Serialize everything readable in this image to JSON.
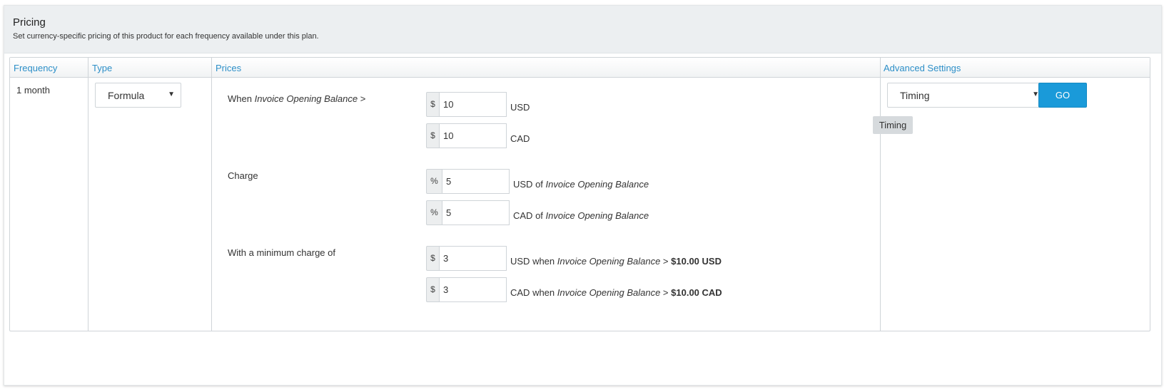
{
  "panel": {
    "title": "Pricing",
    "subtitle": "Set currency-specific pricing of this product for each frequency available under this plan."
  },
  "table": {
    "headers": {
      "frequency": "Frequency",
      "type": "Type",
      "prices": "Prices",
      "advanced": "Advanced Settings"
    },
    "row": {
      "frequency": "1 month",
      "type_selected": "Formula"
    }
  },
  "prices": {
    "when_label_prefix": "When ",
    "when_label_italic": "Invoice Opening Balance",
    "when_label_suffix": " >",
    "charge_label": "Charge",
    "minimum_label": "With a minimum charge of",
    "when_rows": [
      {
        "addon": "$",
        "value": "10",
        "currency": "USD"
      },
      {
        "addon": "$",
        "value": "10",
        "currency": "CAD"
      }
    ],
    "charge_rows": [
      {
        "addon": "%",
        "value": "5",
        "currency": "USD",
        "of_text": " of ",
        "ref": "Invoice Opening Balance"
      },
      {
        "addon": "%",
        "value": "5",
        "currency": "CAD",
        "of_text": " of ",
        "ref": "Invoice Opening Balance"
      }
    ],
    "minimum_rows": [
      {
        "addon": "$",
        "value": "3",
        "currency": "USD",
        "when_text": " when ",
        "ref": "Invoice Opening Balance",
        "gt": " > ",
        "threshold": "$10.00 USD"
      },
      {
        "addon": "$",
        "value": "3",
        "currency": "CAD",
        "when_text": " when ",
        "ref": "Invoice Opening Balance",
        "gt": " > ",
        "threshold": "$10.00 CAD"
      }
    ]
  },
  "advanced": {
    "select_value": "Timing",
    "go_label": "GO",
    "tag_label": "Timing"
  },
  "colors": {
    "accent": "#1a9ad9",
    "header_text": "#2d8fc8",
    "panel_header_bg": "#eceff1"
  },
  "icons": {
    "select_caret": "chevron-down-icon"
  }
}
